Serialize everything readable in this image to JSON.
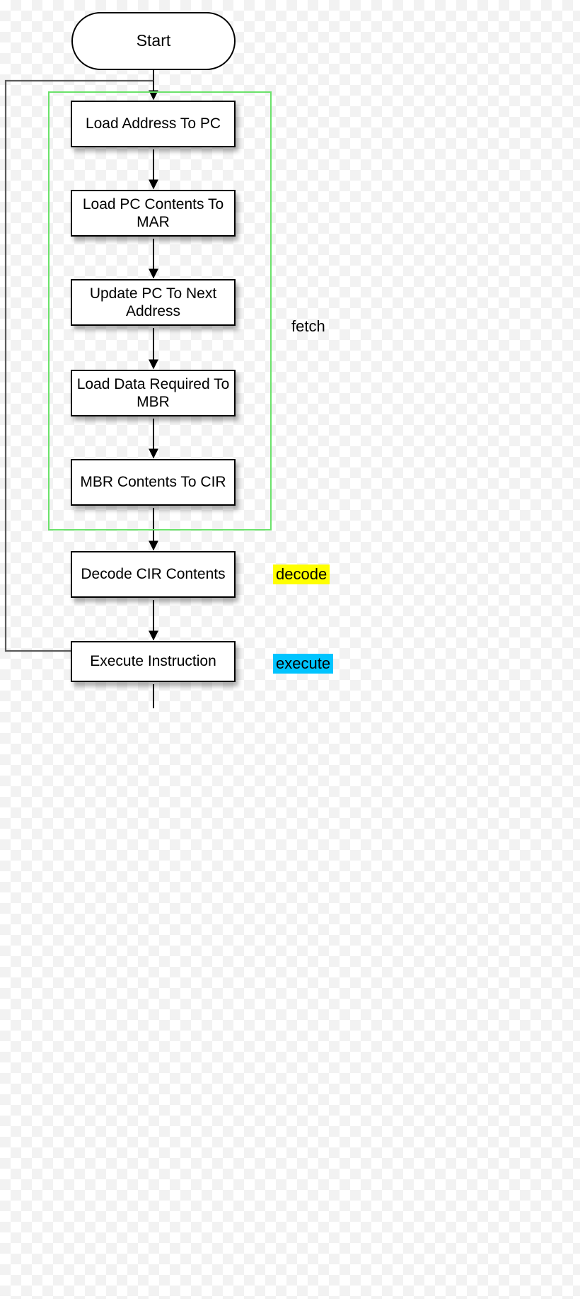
{
  "title": "Start",
  "boxes": {
    "load_addr": "Load Address To PC",
    "load_pc_mar": "Load PC Contents To MAR",
    "update_pc": "Update PC To Next Address",
    "load_mbr": "Load Data Required To MBR",
    "mbr_cir": "MBR Contents To CIR",
    "decode": "Decode CIR Contents",
    "execute": "Execute Instruction"
  },
  "phases": {
    "fetch": "fetch",
    "decode": "decode",
    "execute": "execute"
  },
  "colors": {
    "fetch_border": "#6be26b",
    "decode_bg": "#ffff00",
    "execute_bg": "#00c4ff"
  }
}
